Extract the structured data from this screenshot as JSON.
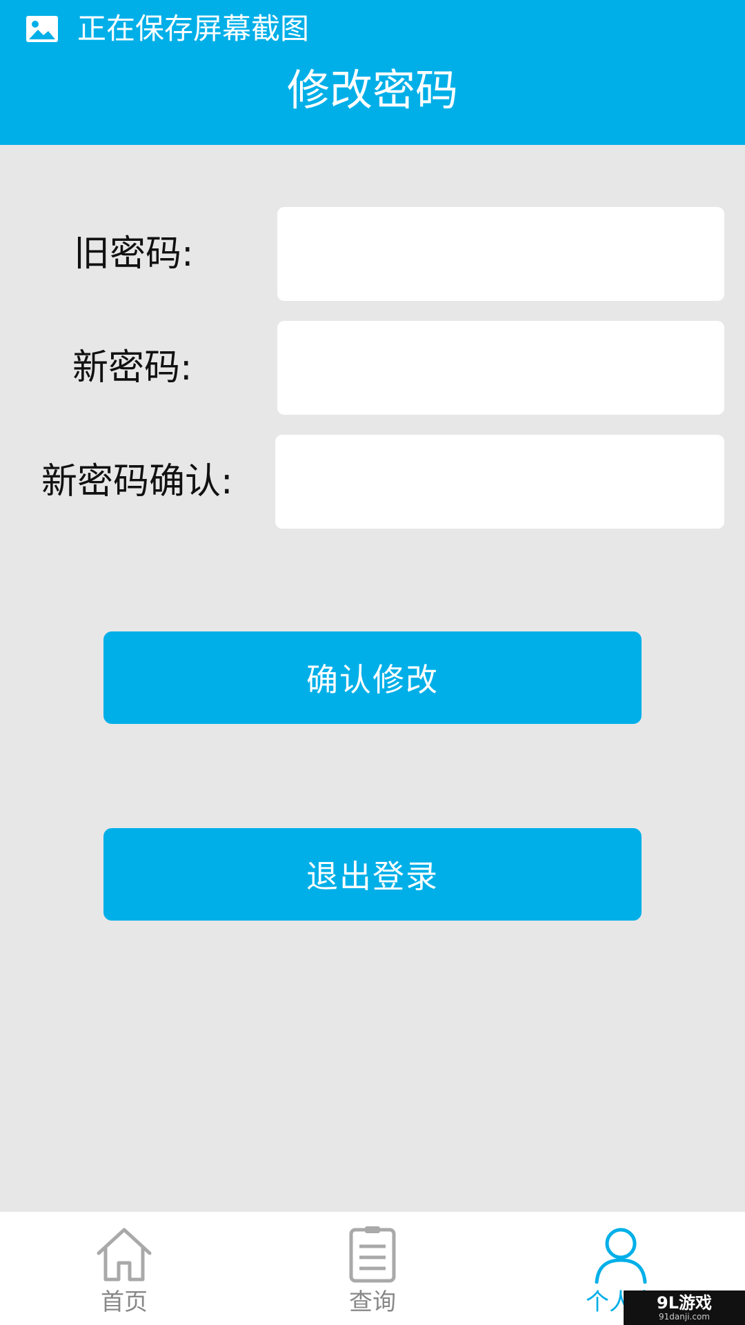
{
  "status_bar": {
    "icon": "image-icon",
    "text": "正在保存屏幕截图"
  },
  "header": {
    "title": "修改密码"
  },
  "form": {
    "old_password": {
      "label": "旧密码:",
      "value": "",
      "placeholder": ""
    },
    "new_password": {
      "label": "新密码:",
      "value": "",
      "placeholder": ""
    },
    "confirm_password": {
      "label": "新密码确认:",
      "value": "",
      "placeholder": ""
    }
  },
  "buttons": {
    "confirm_label": "确认修改",
    "logout_label": "退出登录"
  },
  "bottom_nav": {
    "items": [
      {
        "label": "首页",
        "icon": "home-icon",
        "active": false
      },
      {
        "label": "查询",
        "icon": "clipboard-icon",
        "active": false
      },
      {
        "label": "个人中",
        "icon": "user-icon",
        "active": true
      }
    ]
  },
  "watermark": {
    "main": "9L游戏",
    "sub": "91danji.com"
  },
  "colors": {
    "accent": "#00afe8",
    "background": "#e7e7e8",
    "inactive_icon": "#a9a9a9",
    "inactive_text": "#888888"
  }
}
